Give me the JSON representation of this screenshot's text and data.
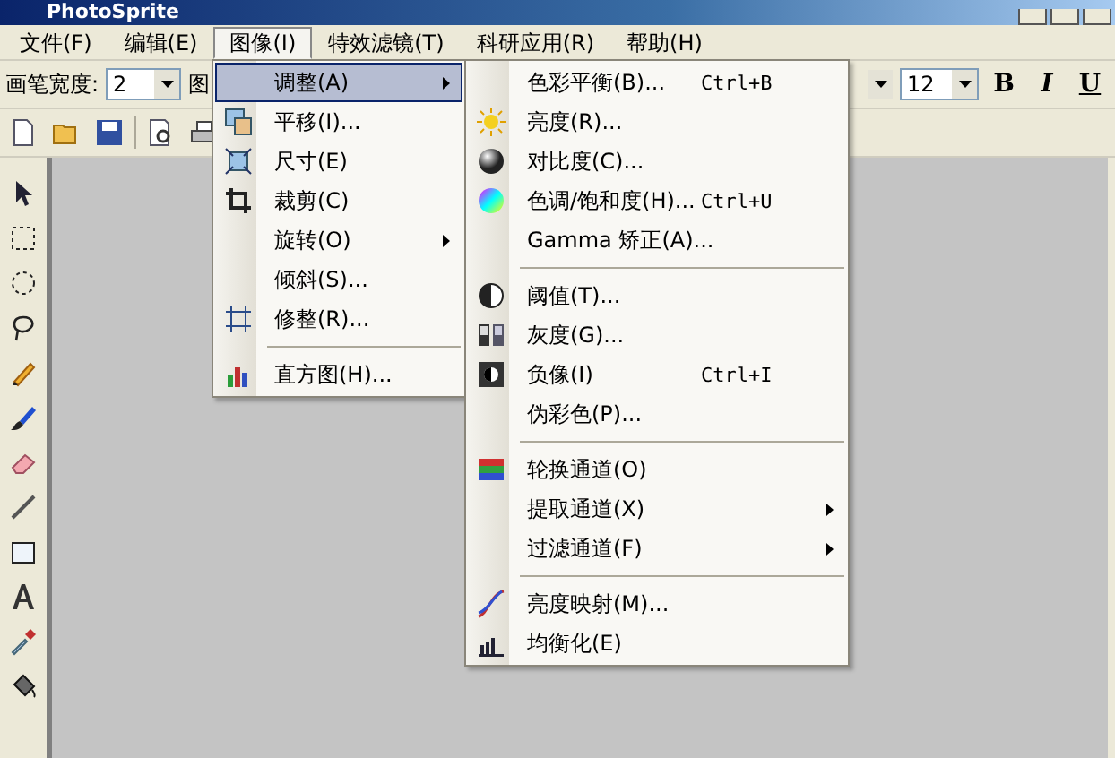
{
  "window": {
    "title": "PhotoSprite"
  },
  "menu_bar": [
    {
      "label": "文件(F)",
      "selected": false
    },
    {
      "label": "编辑(E)",
      "selected": false
    },
    {
      "label": "图像(I)",
      "selected": true
    },
    {
      "label": "特效滤镜(T)",
      "selected": false
    },
    {
      "label": "科研应用(R)",
      "selected": false
    },
    {
      "label": "帮助(H)",
      "selected": false
    }
  ],
  "toolbar": {
    "pen_width_label": "画笔宽度:",
    "pen_width_value": "2",
    "covered_label": "图",
    "font_size_value": "12",
    "format_buttons": [
      "B",
      "I",
      "U"
    ]
  },
  "image_menu": [
    {
      "kind": "item",
      "label": "调整(A)",
      "submenu": true,
      "selected": true
    },
    {
      "kind": "item",
      "label": "平移(I)...",
      "submenu": false,
      "selected": false
    },
    {
      "kind": "item",
      "label": "尺寸(E)",
      "submenu": false,
      "selected": false
    },
    {
      "kind": "item",
      "label": "裁剪(C)",
      "submenu": false,
      "selected": false
    },
    {
      "kind": "item",
      "label": "旋转(O)",
      "submenu": true,
      "selected": false
    },
    {
      "kind": "item",
      "label": "倾斜(S)...",
      "submenu": false,
      "selected": false
    },
    {
      "kind": "item",
      "label": "修整(R)...",
      "submenu": false,
      "selected": false
    },
    {
      "kind": "separator"
    },
    {
      "kind": "item",
      "label": "直方图(H)...",
      "submenu": false,
      "selected": false
    }
  ],
  "adjust_submenu": [
    {
      "kind": "item",
      "label": "色彩平衡(B)...",
      "shortcut": "Ctrl+B",
      "submenu": false
    },
    {
      "kind": "item",
      "label": "亮度(R)...",
      "submenu": false
    },
    {
      "kind": "item",
      "label": "对比度(C)...",
      "submenu": false
    },
    {
      "kind": "item",
      "label": "色调/饱和度(H)...",
      "shortcut": "Ctrl+U",
      "submenu": false
    },
    {
      "kind": "item",
      "label": "Gamma 矫正(A)...",
      "submenu": false
    },
    {
      "kind": "separator"
    },
    {
      "kind": "item",
      "label": "阈值(T)...",
      "submenu": false
    },
    {
      "kind": "item",
      "label": "灰度(G)...",
      "submenu": false
    },
    {
      "kind": "item",
      "label": "负像(I)",
      "shortcut": "Ctrl+I",
      "submenu": false
    },
    {
      "kind": "item",
      "label": "伪彩色(P)...",
      "submenu": false
    },
    {
      "kind": "separator"
    },
    {
      "kind": "item",
      "label": "轮换通道(O)",
      "submenu": false
    },
    {
      "kind": "item",
      "label": "提取通道(X)",
      "submenu": true
    },
    {
      "kind": "item",
      "label": "过滤通道(F)",
      "submenu": true
    },
    {
      "kind": "separator"
    },
    {
      "kind": "item",
      "label": "亮度映射(M)...",
      "submenu": false
    },
    {
      "kind": "item",
      "label": "均衡化(E)",
      "submenu": false
    }
  ]
}
